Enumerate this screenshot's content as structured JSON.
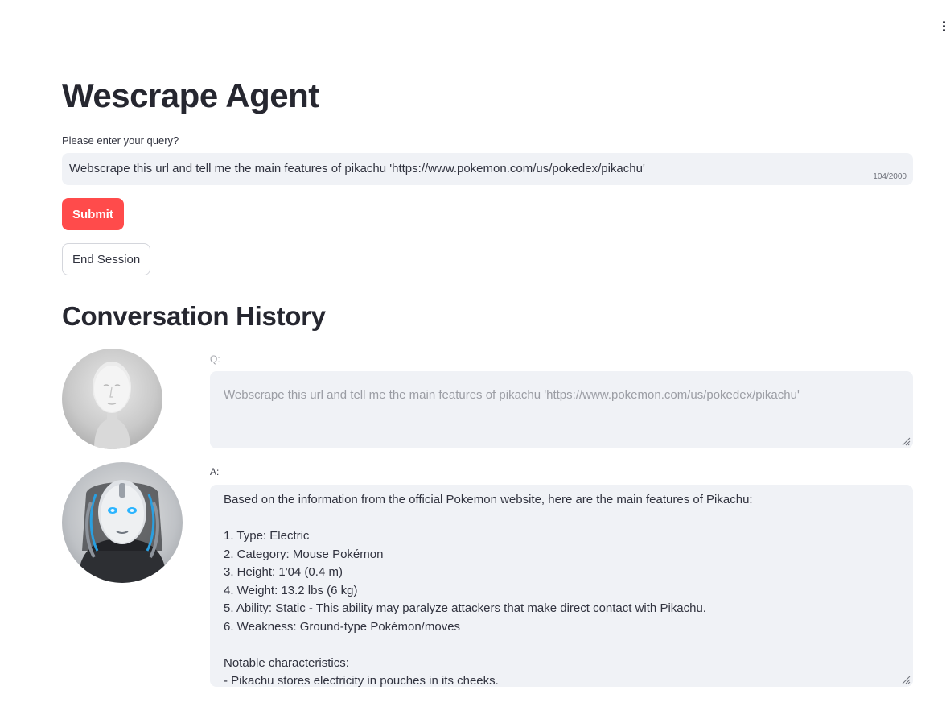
{
  "app": {
    "title": "Wescrape Agent"
  },
  "query": {
    "label": "Please enter your query?",
    "value": "Webscrape this url and tell me the main features of pikachu 'https://www.pokemon.com/us/pokedex/pikachu'",
    "char_count": "104/2000"
  },
  "buttons": {
    "submit": "Submit",
    "end_session": "End Session"
  },
  "history": {
    "heading": "Conversation History",
    "question_label": "Q:",
    "question_text": "Webscrape this url and tell me the main features of pikachu 'https://www.pokemon.com/us/pokedex/pikachu'",
    "answer_label": "A:",
    "answer_lines": [
      "Based on the information from the official Pokemon website, here are the main features of Pikachu:",
      "",
      "1. Type: Electric",
      "2. Category: Mouse Pokémon",
      "3. Height: 1'04 (0.4 m)",
      "4. Weight: 13.2 lbs (6 kg)",
      "5. Ability: Static - This ability may paralyze attackers that make direct contact with Pikachu.",
      "6. Weakness: Ground-type Pokémon/moves",
      "",
      "Notable characteristics:",
      "- Pikachu stores electricity in pouches in its cheeks."
    ]
  },
  "icons": {
    "menu": "kebab-menu-icon",
    "user_avatar": "mannequin-avatar-icon",
    "bot_avatar": "robot-avatar-icon",
    "resize": "resize-handle-icon"
  },
  "colors": {
    "primary": "#ff4b4b",
    "input_bg": "#f0f2f6",
    "text": "#31333f"
  }
}
